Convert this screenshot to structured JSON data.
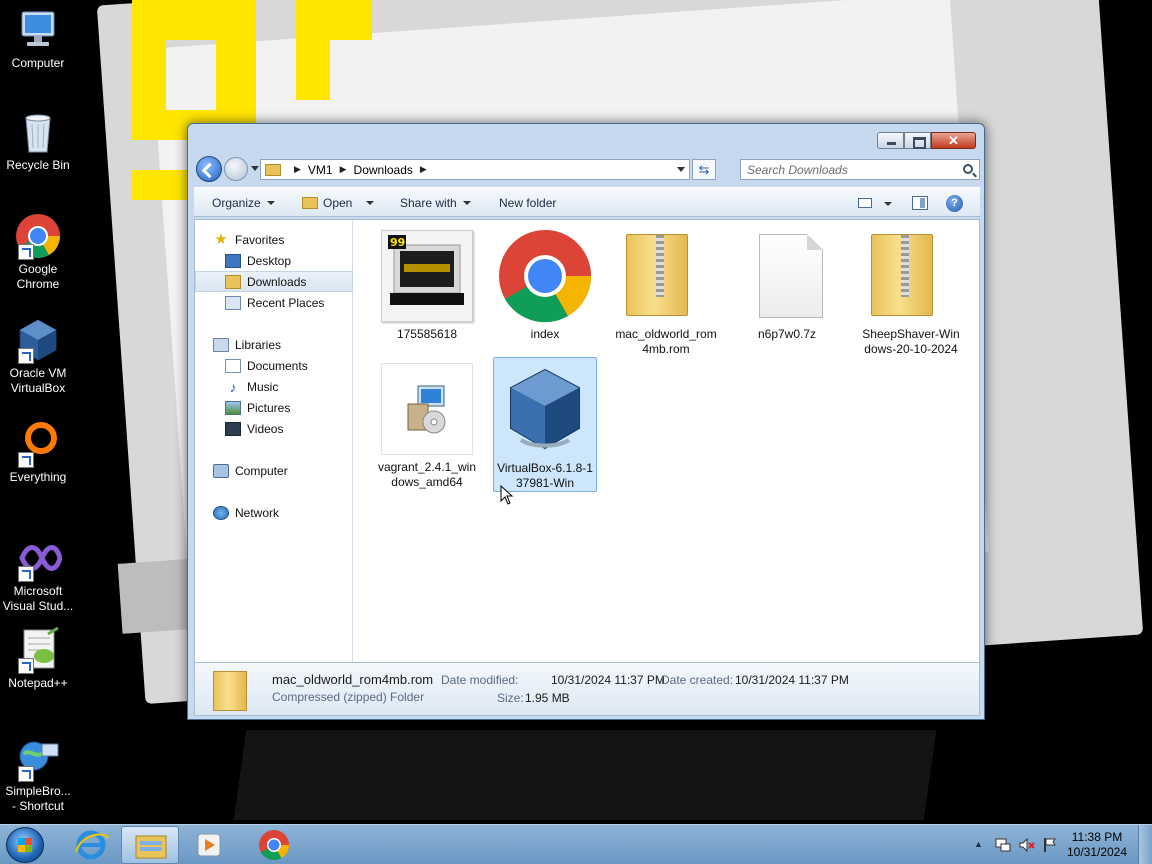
{
  "desktop": {
    "icons": [
      {
        "label": "Computer"
      },
      {
        "label": "Recycle Bin"
      },
      {
        "label": "Google Chrome"
      },
      {
        "label": "Oracle VM VirtualBox"
      },
      {
        "label": "Everything"
      },
      {
        "label": "Microsoft Visual Stud..."
      },
      {
        "label": "Notepad++"
      },
      {
        "label": "SimpleBro... - Shortcut"
      }
    ]
  },
  "window": {
    "breadcrumb": [
      "VM1",
      "Downloads"
    ],
    "search_placeholder": "Search Downloads",
    "toolbar": {
      "organize": "Organize",
      "open": "Open",
      "share_with": "Share with",
      "new_folder": "New folder"
    },
    "nav": {
      "favorites": "Favorites",
      "desktop": "Desktop",
      "downloads": "Downloads",
      "recent_places": "Recent Places",
      "libraries": "Libraries",
      "documents": "Documents",
      "music": "Music",
      "pictures": "Pictures",
      "videos": "Videos",
      "computer": "Computer",
      "network": "Network"
    },
    "files": [
      {
        "name": "175585618"
      },
      {
        "name": "index"
      },
      {
        "name": "mac_oldworld_rom4mb.rom"
      },
      {
        "name": "n6p7w0.7z"
      },
      {
        "name": "SheepShaver-Windows-20-10-2024"
      },
      {
        "name": "vagrant_2.4.1_windows_amd64"
      },
      {
        "name": "VirtualBox-6.1.8-137981-Win"
      }
    ],
    "details": {
      "name": "mac_oldworld_rom4mb.rom",
      "type": "Compressed (zipped) Folder",
      "date_modified_label": "Date modified:",
      "date_modified": "10/31/2024 11:37 PM",
      "date_created_label": "Date created:",
      "date_created": "10/31/2024 11:37 PM",
      "size_label": "Size:",
      "size": "1.95 MB"
    }
  },
  "taskbar": {
    "time": "11:38 PM",
    "date": "10/31/2024"
  },
  "colors": {
    "selection": "#cde6fb",
    "taskbar": "#7aa5cf",
    "wallpaper_accent": "#ffe600"
  }
}
